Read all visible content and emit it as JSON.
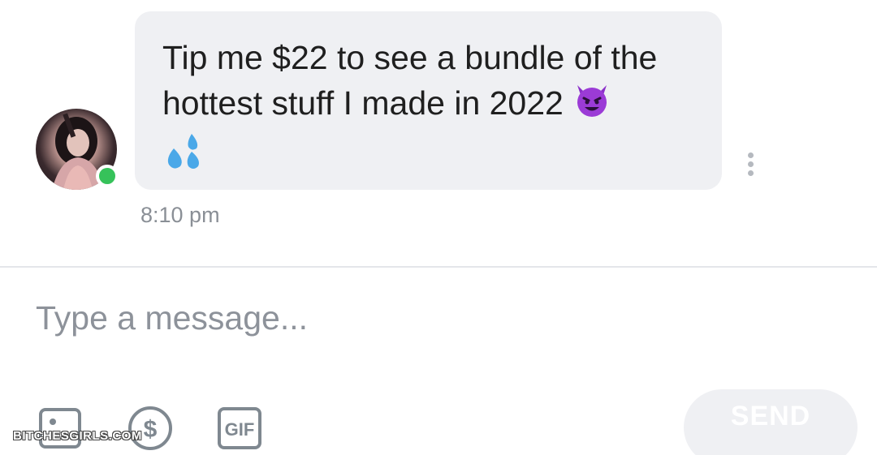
{
  "message": {
    "text_line1": "Tip me $22 to see a bundle of the",
    "text_line2": "hottest stuff I made in 2022",
    "emoji1": "smiling-devil",
    "emoji2": "sweat-droplets",
    "timestamp": "8:10 pm",
    "sender_status": "online"
  },
  "composer": {
    "placeholder": "Type a message...",
    "send_label": "SEND",
    "tools": [
      "image-icon",
      "dollar-icon",
      "gif-icon"
    ]
  },
  "watermark": "BITCHESGIRLS.COM",
  "colors": {
    "bubble": "#eff0f3",
    "online": "#36c25a",
    "icon": "#7f8890",
    "send_bg": "#eff0f3",
    "timestamp": "#8a8f96"
  }
}
